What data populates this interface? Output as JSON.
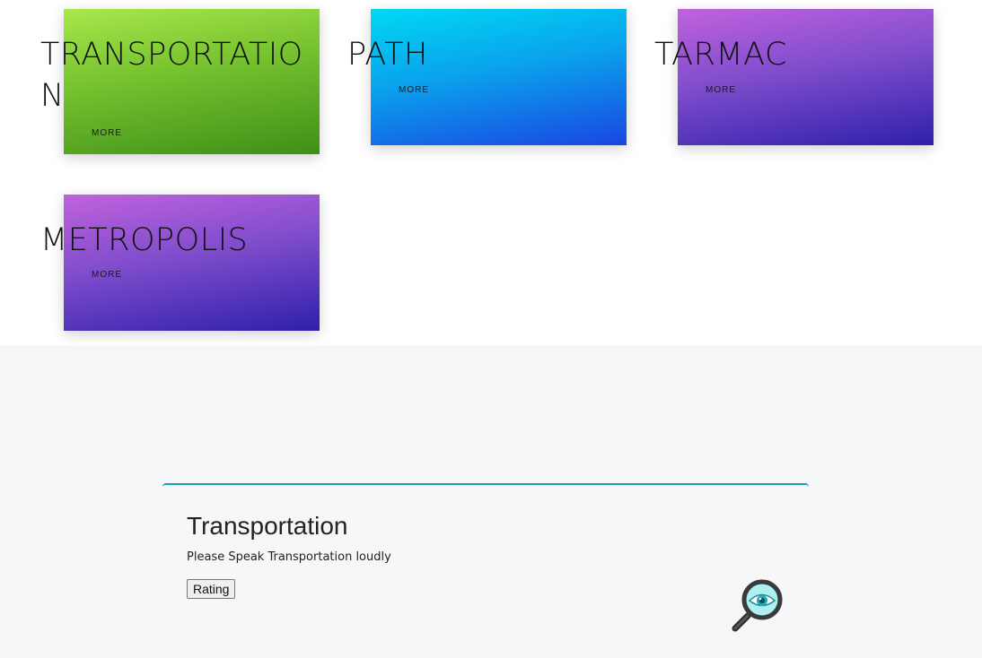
{
  "cards": [
    {
      "title": "TRANSPORTATION",
      "more_label": "MORE",
      "gradient": "green"
    },
    {
      "title": "PATH",
      "more_label": "MORE",
      "gradient": "blue"
    },
    {
      "title": "TARMAC",
      "more_label": "MORE",
      "gradient": "purple"
    },
    {
      "title": "METROPOLIS",
      "more_label": "MORE",
      "gradient": "purple"
    }
  ],
  "detail": {
    "title": "Transportation",
    "subtitle": "Please Speak Transportation loudly",
    "rating_label": "Rating",
    "icon": "magnifier-eye-icon"
  },
  "colors": {
    "accent_teal": "#17a2b8",
    "bottom_bg": "#f6f7f9",
    "green_start": "#a8e84b",
    "green_end": "#3f8f18",
    "blue_start": "#00d9f4",
    "blue_end": "#1a46e2",
    "purple_start": "#c162de",
    "purple_end": "#2f20ab"
  }
}
